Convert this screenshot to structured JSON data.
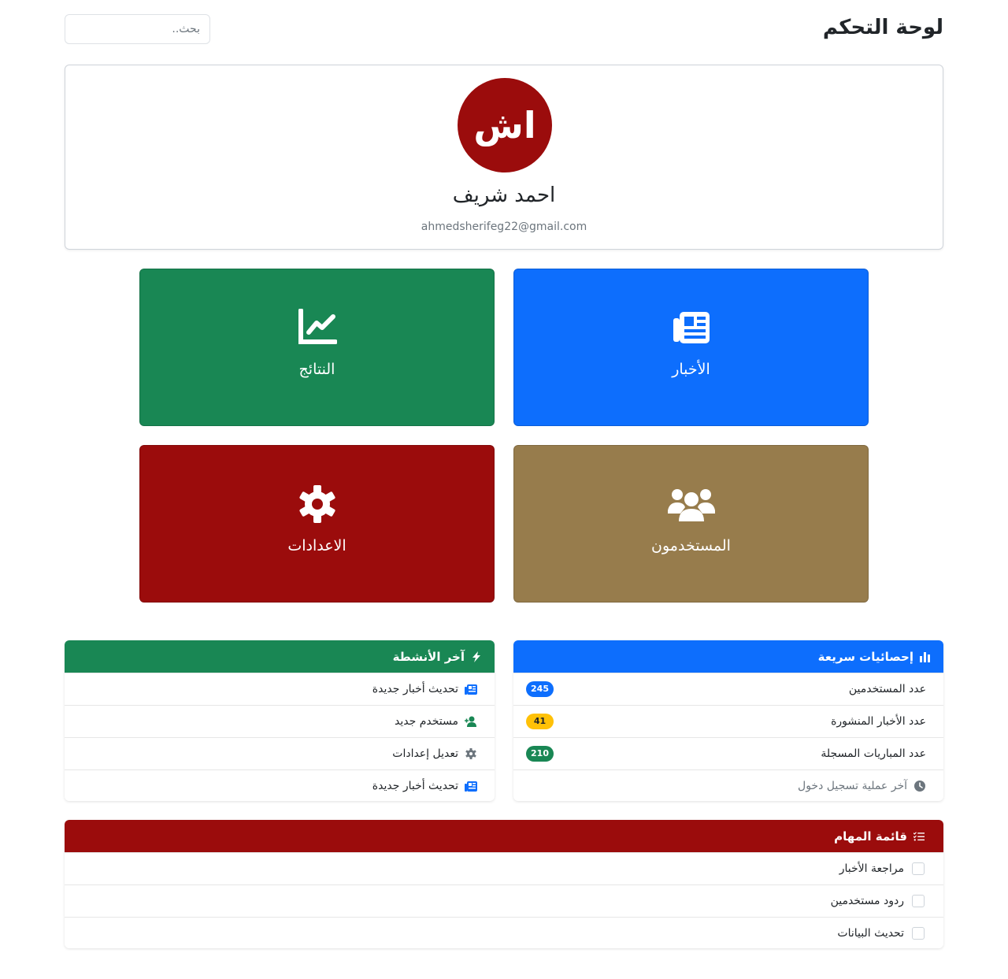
{
  "header": {
    "title": "لوحة التحكم",
    "search_placeholder": "بحث.."
  },
  "profile": {
    "avatar_initials": "اش",
    "avatar_color": "#9b0c0c",
    "name": "احمد شريف",
    "email": "ahmedsherifeg22@gmail.com"
  },
  "tiles": {
    "news": {
      "label": "الأخبار",
      "icon": "newspaper-icon",
      "color": "#0d6efd"
    },
    "results": {
      "label": "النتائج",
      "icon": "chart-line-icon",
      "color": "#198754"
    },
    "users": {
      "label": "المستخدمون",
      "icon": "users-icon",
      "color": "#977c4c"
    },
    "settings": {
      "label": "الاعدادات",
      "icon": "gear-icon",
      "color": "#9b0c0c"
    }
  },
  "stats": {
    "title": "إحصائيات سريعة",
    "icon": "bar-chart-icon",
    "color": "#0d6efd",
    "rows": [
      {
        "label": "عدد المستخدمين",
        "value": "245",
        "badge_color": "#0d6efd",
        "badge_text_color": "#ffffff"
      },
      {
        "label": "عدد الأخبار المنشورة",
        "value": "41",
        "badge_color": "#ffc107",
        "badge_text_color": "#212529"
      },
      {
        "label": "عدد المباريات المسجلة",
        "value": "210",
        "badge_color": "#198754",
        "badge_text_color": "#ffffff"
      }
    ],
    "last_login": {
      "label": "آخر عملية تسجيل دخول",
      "icon": "clock-icon"
    }
  },
  "activity": {
    "title": "آخر الأنشطة",
    "icon": "bolt-icon",
    "color": "#198754",
    "items": [
      {
        "label": "تحديث أخبار جديدة",
        "icon": "newspaper-icon",
        "icon_color": "#0d6efd"
      },
      {
        "label": "مستخدم جديد",
        "icon": "user-plus-icon",
        "icon_color": "#198754"
      },
      {
        "label": "تعديل إعدادات",
        "icon": "gear-icon",
        "icon_color": "#6c757d"
      },
      {
        "label": "تحديث أخبار جديدة",
        "icon": "newspaper-icon",
        "icon_color": "#0d6efd"
      }
    ]
  },
  "tasks": {
    "title": "قائمة المهام",
    "icon": "list-check-icon",
    "color": "#9b0c0c",
    "items": [
      {
        "label": "مراجعة الأخبار",
        "checked": false
      },
      {
        "label": "ردود مستخدمين",
        "checked": false
      },
      {
        "label": "تحديث البيانات",
        "checked": false
      }
    ]
  }
}
